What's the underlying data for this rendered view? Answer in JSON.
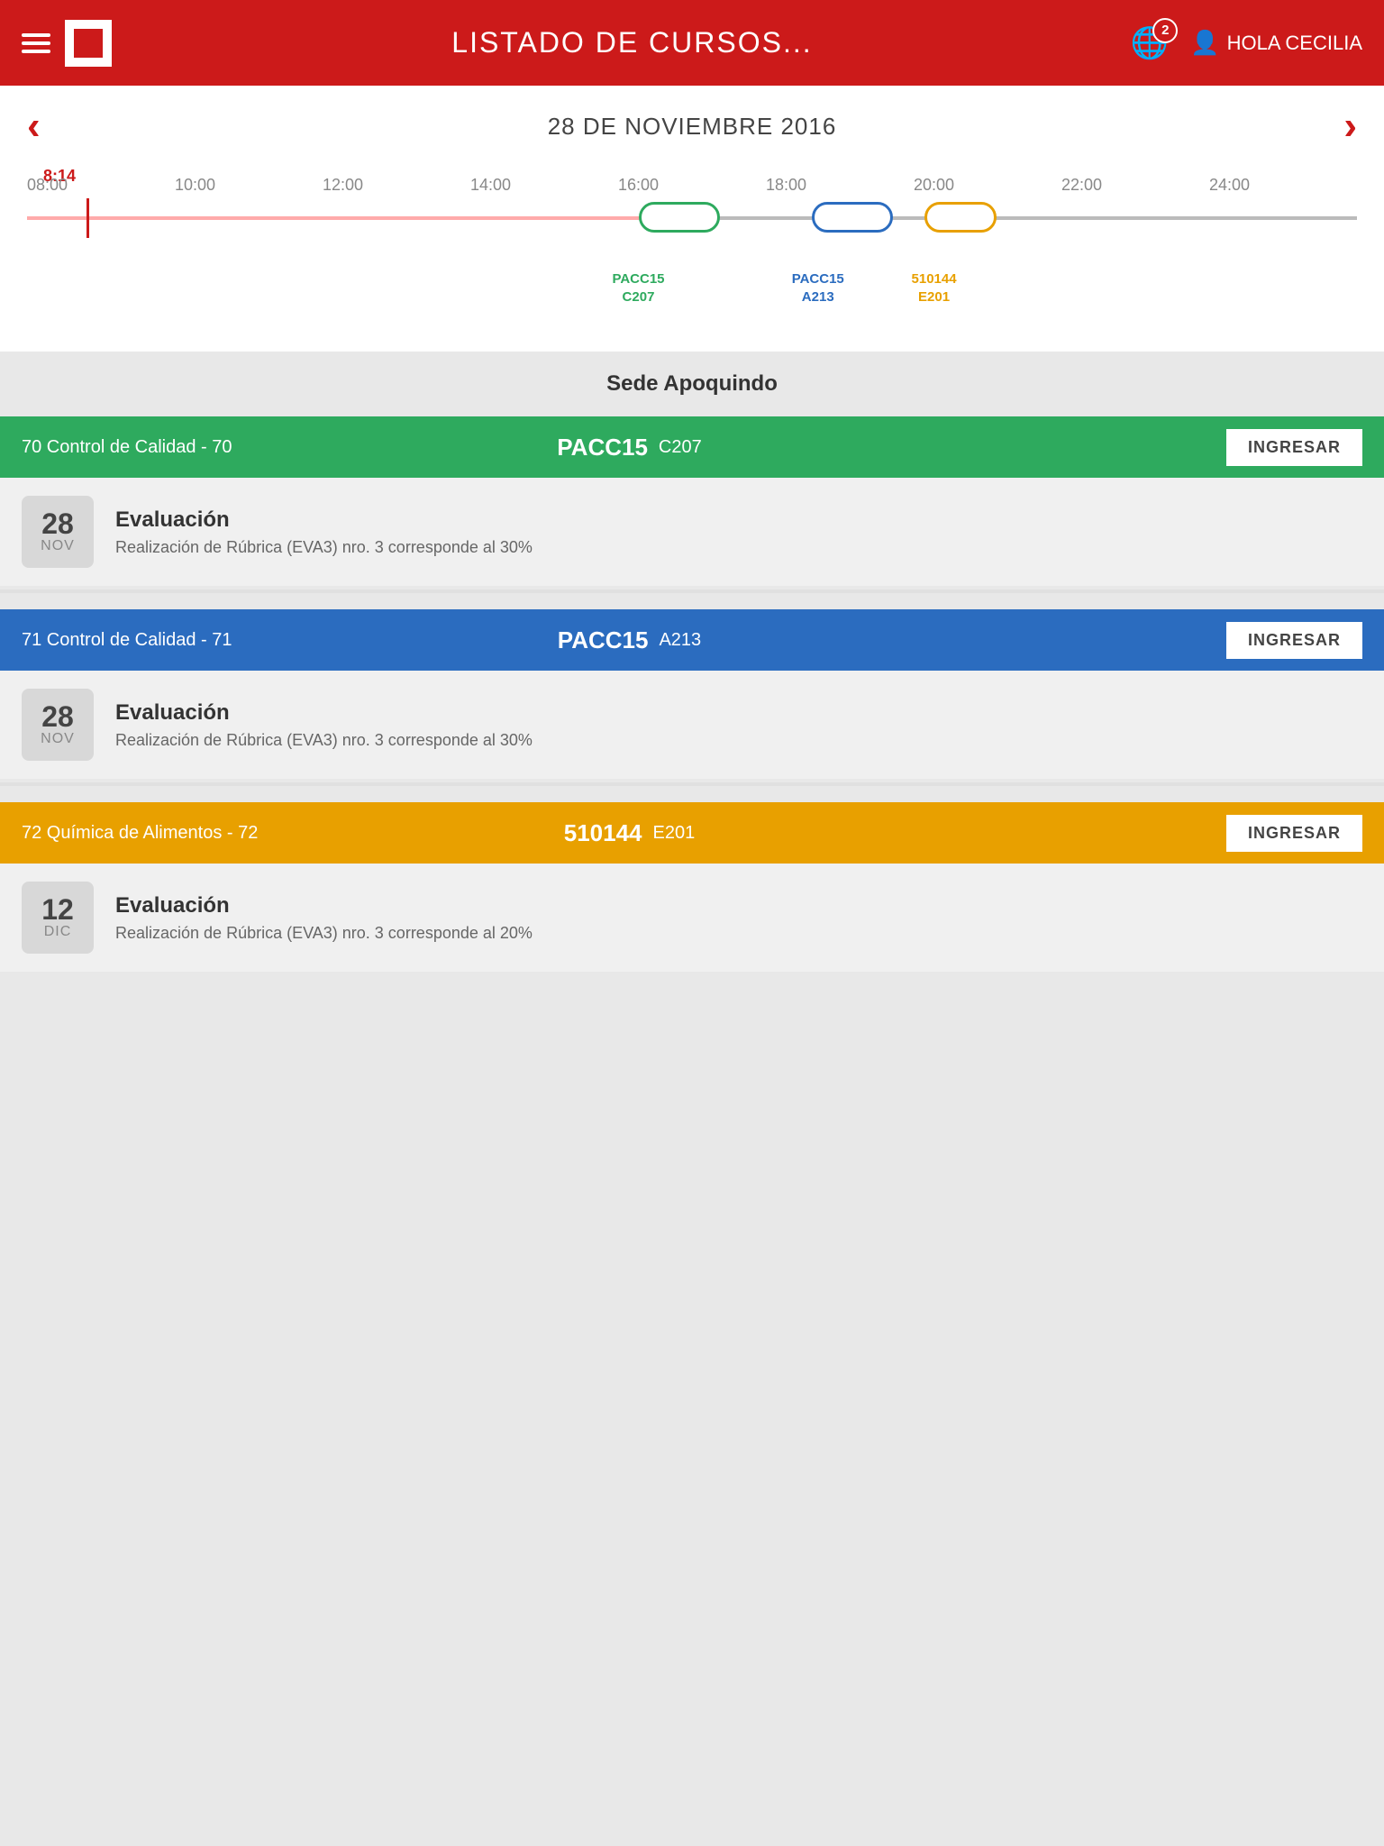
{
  "header": {
    "title": "LISTADO DE CURSOS...",
    "user_greeting": "HOLA CECILIA",
    "notification_count": "2"
  },
  "date_nav": {
    "date_label": "28 DE NOVIEMBRE 2016",
    "prev_arrow": "‹",
    "next_arrow": "›"
  },
  "timeline": {
    "current_time": "8:14",
    "hours": [
      "08:00",
      "10:00",
      "12:00",
      "14:00",
      "16:00",
      "18:00",
      "20:00",
      "22:00",
      "24:00"
    ],
    "bubbles": [
      {
        "id": "green",
        "label_line1": "PACC15",
        "label_line2": "C207"
      },
      {
        "id": "blue",
        "label_line1": "PACC15",
        "label_line2": "A213"
      },
      {
        "id": "yellow",
        "label_line1": "510144",
        "label_line2": "E201"
      }
    ]
  },
  "sede": {
    "label": "Sede Apoquindo"
  },
  "courses": [
    {
      "id": "course-70",
      "color": "green",
      "number": "70 Control de Calidad - 70",
      "code": "PACC15",
      "room": "C207",
      "btn_label": "INGRESAR",
      "event": {
        "day": "28",
        "month": "NOV",
        "title": "Evaluación",
        "description": "Realización de Rúbrica (EVA3) nro. 3 corresponde al 30%"
      }
    },
    {
      "id": "course-71",
      "color": "blue",
      "number": "71 Control de Calidad - 71",
      "code": "PACC15",
      "room": "A213",
      "btn_label": "INGRESAR",
      "event": {
        "day": "28",
        "month": "NOV",
        "title": "Evaluación",
        "description": "Realización de Rúbrica (EVA3) nro. 3 corresponde al 30%"
      }
    },
    {
      "id": "course-72",
      "color": "yellow",
      "number": "72 Química de Alimentos - 72",
      "code": "510144",
      "room": "E201",
      "btn_label": "INGRESAR",
      "event": {
        "day": "12",
        "month": "DIC",
        "title": "Evaluación",
        "description": "Realización de Rúbrica (EVA3) nro. 3 corresponde al 20%"
      }
    }
  ]
}
